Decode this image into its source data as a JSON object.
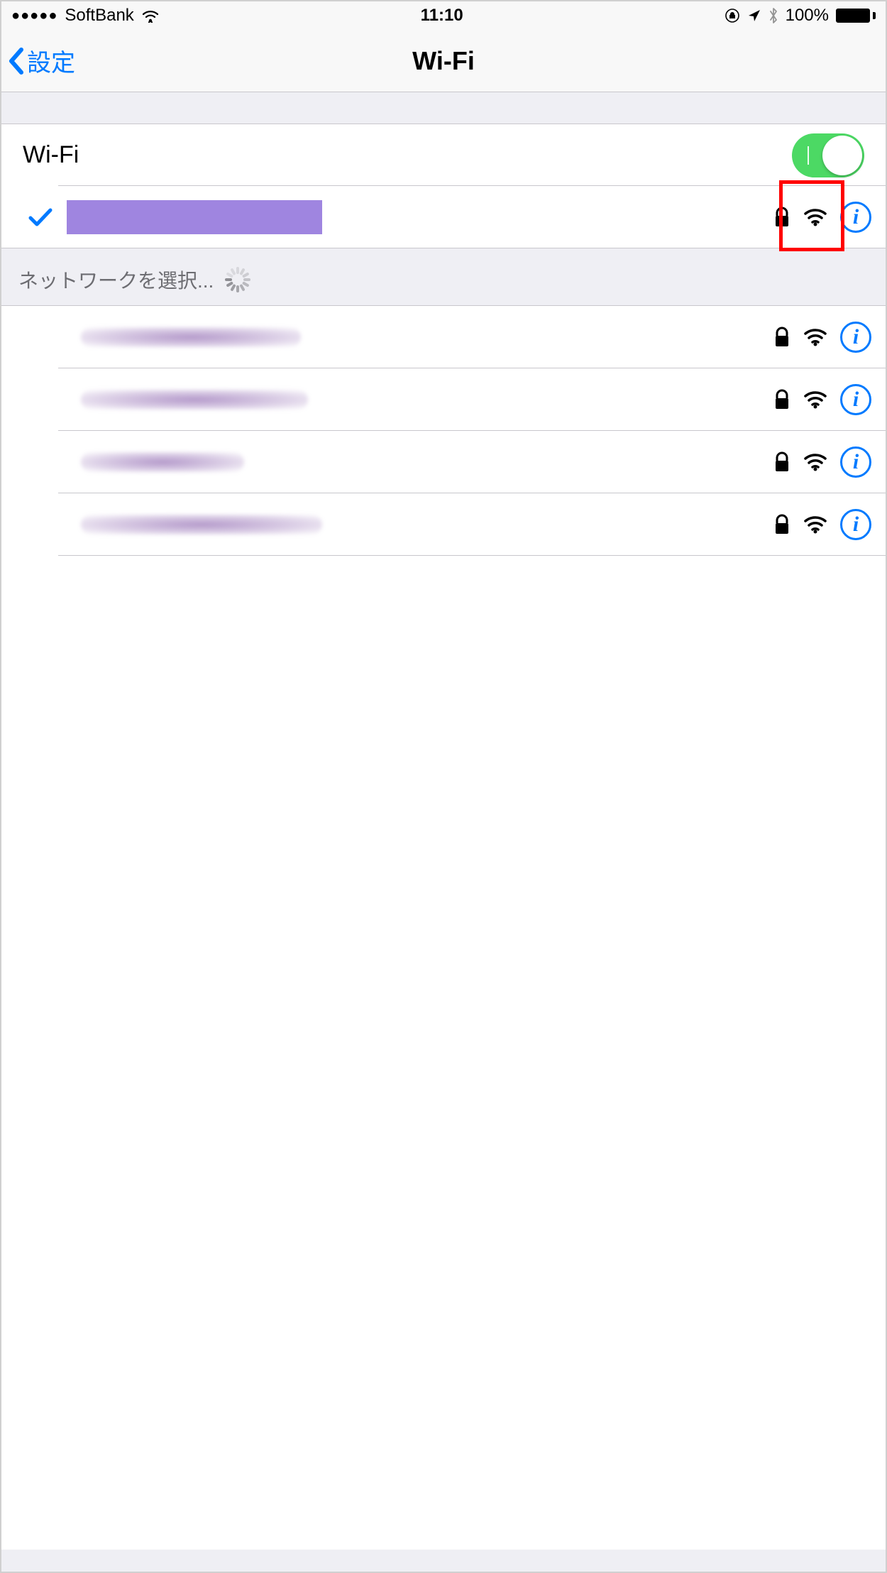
{
  "status_bar": {
    "carrier": "SoftBank",
    "time": "11:10",
    "battery_pct": "100%"
  },
  "nav": {
    "back_label": "設定",
    "title": "Wi-Fi"
  },
  "wifi_toggle": {
    "label": "Wi-Fi",
    "on": true
  },
  "connected": {
    "checked": true
  },
  "networks_header": "ネットワークを選択...",
  "networks": [
    {
      "secured": true
    },
    {
      "secured": true
    },
    {
      "secured": true
    },
    {
      "secured": true
    }
  ],
  "colors": {
    "tint": "#007aff",
    "toggle_on": "#4cd964",
    "redact": "#9f85e0",
    "highlight": "#ff0000"
  }
}
